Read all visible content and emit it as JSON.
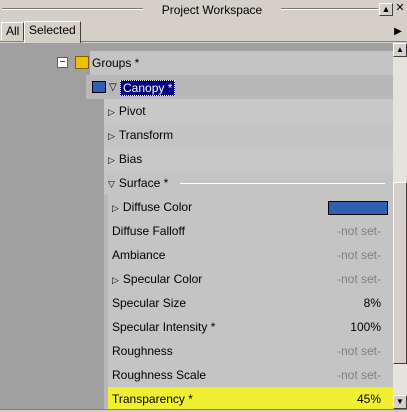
{
  "window": {
    "title": "Project Workspace"
  },
  "tabs": [
    {
      "label": "All",
      "active": false
    },
    {
      "label": "Selected",
      "active": true
    }
  ],
  "tree": {
    "groups": {
      "label": "Groups *"
    },
    "canopy": {
      "label": "Canopy *",
      "color": "#3060b0"
    },
    "sections": [
      {
        "label": "Pivot"
      },
      {
        "label": "Transform"
      },
      {
        "label": "Bias"
      }
    ],
    "surface": {
      "label": "Surface *",
      "properties": [
        {
          "label": "Diffuse Color",
          "value": "",
          "swatch": "#3060b0"
        },
        {
          "label": "Diffuse Falloff",
          "value": "-not set-"
        },
        {
          "label": "Ambiance",
          "value": "-not set-"
        },
        {
          "label": "Specular Color",
          "value": "-not set-"
        },
        {
          "label": "Specular Size",
          "value": "8%"
        },
        {
          "label": "Specular Intensity *",
          "value": "100%"
        },
        {
          "label": "Roughness",
          "value": "-not set-"
        },
        {
          "label": "Roughness Scale",
          "value": "-not set-"
        },
        {
          "label": "Transparency *",
          "value": "45%"
        }
      ]
    }
  },
  "colors": {
    "highlight": "#f0f030",
    "selection": "#000080"
  }
}
